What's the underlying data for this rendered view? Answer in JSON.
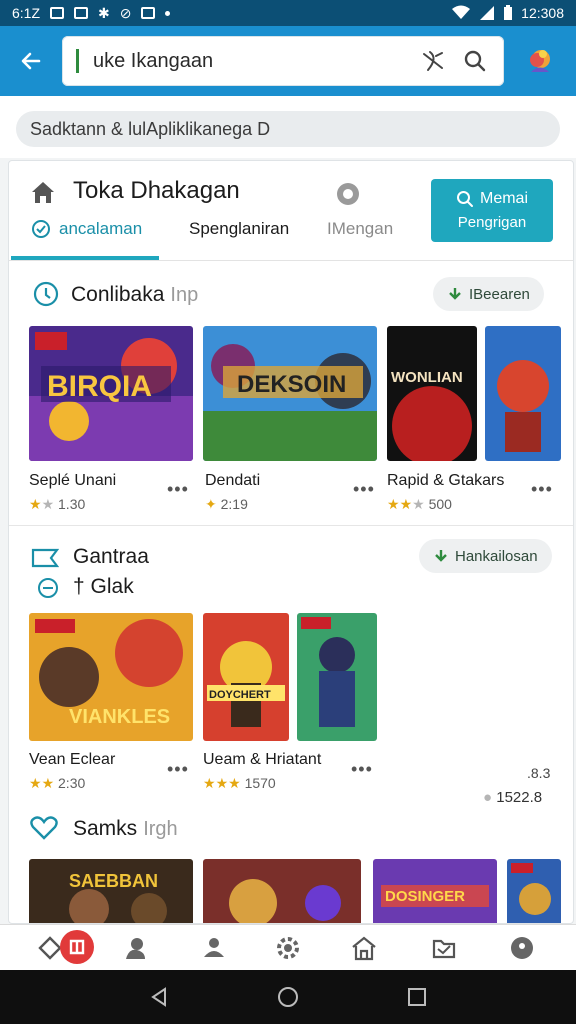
{
  "status_bar": {
    "time_left": "6:1Z",
    "time_right": "12:308"
  },
  "search": {
    "query": "uke Ikangaan"
  },
  "suggestion": {
    "text": "Sadktann & lulApliklikanega D"
  },
  "store": {
    "title": "Toka Dhakagan",
    "cta_line1": "Memai",
    "cta_line2": "Pengrigan",
    "tabs": [
      "ancalaman",
      "Spenglaniran",
      "IMengan"
    ]
  },
  "sections": [
    {
      "title": "Conlibaka",
      "subtitle": "Inp",
      "action": "IBeearen",
      "items": [
        {
          "name": "Seplé Unani",
          "rating": "1.30",
          "stars": 2,
          "banner": "BIRQIA"
        },
        {
          "name": "Dendati",
          "rating": "2:19",
          "stars": 0,
          "banner": "DEKSOIN"
        },
        {
          "name": "Rapid & Gtakars",
          "rating": "500",
          "stars": 2,
          "banner": "WONLIAN"
        }
      ]
    },
    {
      "title": "Gantraa",
      "subtitle2": "† Glak",
      "action": "Hankailosan",
      "items": [
        {
          "name": "Vean Eclear",
          "rating": "2:30",
          "stars": 2,
          "banner": "VIANKLES"
        },
        {
          "name": "Ueam & Hriatant",
          "rating": "1570",
          "stars": 3,
          "banner": "DOYCHERT"
        }
      ],
      "extra_top": ".8.3",
      "extra_value": "1522.8"
    },
    {
      "title": "Samks",
      "subtitle": "Irgh",
      "items": [
        {
          "banner": "SAEBBAN"
        },
        {
          "banner": ""
        },
        {
          "banner": "DOSINGER"
        }
      ]
    }
  ],
  "colors": {
    "appbar": "#1a8fcf",
    "statusbar": "#0c4f75",
    "accent": "#1fa7be",
    "star": "#e5a812"
  },
  "icons": {
    "back": "arrow-left-icon",
    "clear": "clear-icon",
    "search": "search-icon",
    "profile": "profile-icon",
    "home": "home-icon"
  }
}
